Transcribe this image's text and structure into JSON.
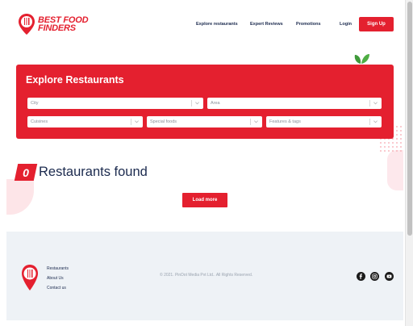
{
  "header": {
    "logo_line1": "BEST FOOD",
    "logo_line2": "FINDERS",
    "nav": [
      "Explore restaurants",
      "Expert Reviews",
      "Promotions",
      "Login"
    ],
    "signup_label": "Sign Up"
  },
  "explore": {
    "title": "Explore Restaurants",
    "fields": {
      "city": "City",
      "area": "Area",
      "cuisines": "Cuisines",
      "special": "Special foods",
      "features": "Features & tags"
    }
  },
  "results": {
    "count": "0",
    "label": "Restaurants found",
    "load_more": "Load more"
  },
  "footer": {
    "links": [
      "Restaurants",
      "About Us",
      "Contact us"
    ],
    "copyright": "© 2021. PinDot Media Pvt Ltd.. All Rights Reserved.",
    "social_icons": [
      "facebook-icon",
      "instagram-icon",
      "youtube-icon"
    ]
  },
  "colors": {
    "brand_red": "#e4202f",
    "navy": "#1b2a4e",
    "footer_bg": "#eef2f6"
  }
}
